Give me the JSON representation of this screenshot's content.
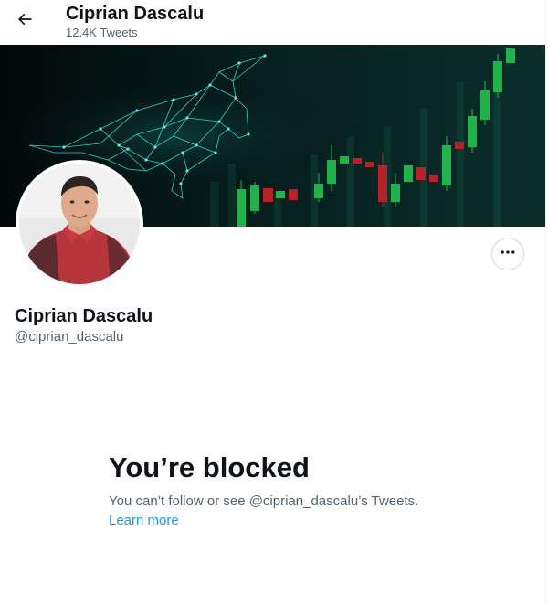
{
  "header": {
    "title": "Ciprian Dascalu",
    "tweet_count": "12.4K Tweets",
    "back_icon": "arrow-left-icon"
  },
  "profile": {
    "name": "Ciprian Dascalu",
    "handle": "@ciprian_dascalu",
    "more_icon": "more-horizontal-icon"
  },
  "blocked": {
    "title": "You’re blocked",
    "description": "You can’t follow or see @ciprian_dascalu’s Tweets.",
    "link": "Learn more"
  },
  "colors": {
    "text_primary": "#0f1419",
    "text_secondary": "#536471",
    "link": "#1d9bf0",
    "banner_bg": "#041214",
    "bull_cyan": "#33e0dc",
    "candle_green": "#22b24c",
    "candle_red": "#b5222a"
  }
}
